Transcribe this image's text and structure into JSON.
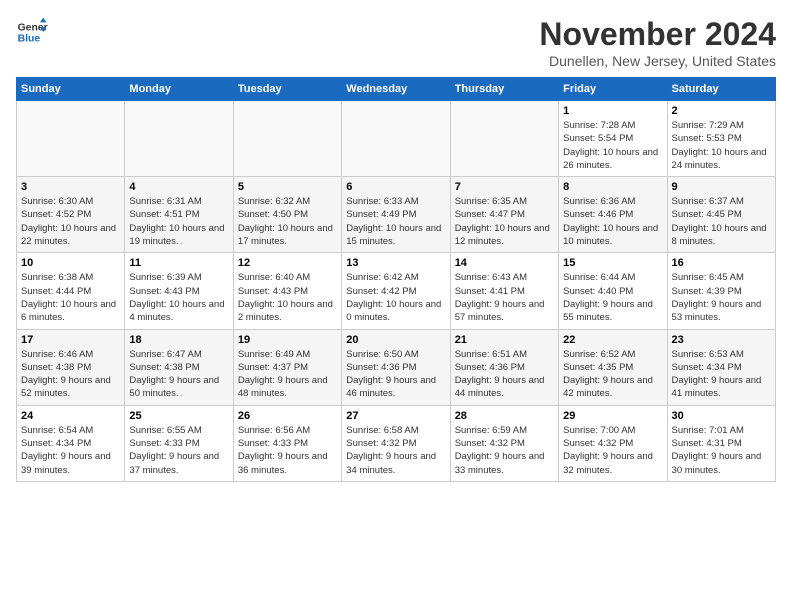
{
  "header": {
    "logo_line1": "General",
    "logo_line2": "Blue",
    "month_title": "November 2024",
    "location": "Dunellen, New Jersey, United States"
  },
  "weekdays": [
    "Sunday",
    "Monday",
    "Tuesday",
    "Wednesday",
    "Thursday",
    "Friday",
    "Saturday"
  ],
  "weeks": [
    [
      {
        "day": "",
        "info": ""
      },
      {
        "day": "",
        "info": ""
      },
      {
        "day": "",
        "info": ""
      },
      {
        "day": "",
        "info": ""
      },
      {
        "day": "",
        "info": ""
      },
      {
        "day": "1",
        "info": "Sunrise: 7:28 AM\nSunset: 5:54 PM\nDaylight: 10 hours and 26 minutes."
      },
      {
        "day": "2",
        "info": "Sunrise: 7:29 AM\nSunset: 5:53 PM\nDaylight: 10 hours and 24 minutes."
      }
    ],
    [
      {
        "day": "3",
        "info": "Sunrise: 6:30 AM\nSunset: 4:52 PM\nDaylight: 10 hours and 22 minutes."
      },
      {
        "day": "4",
        "info": "Sunrise: 6:31 AM\nSunset: 4:51 PM\nDaylight: 10 hours and 19 minutes."
      },
      {
        "day": "5",
        "info": "Sunrise: 6:32 AM\nSunset: 4:50 PM\nDaylight: 10 hours and 17 minutes."
      },
      {
        "day": "6",
        "info": "Sunrise: 6:33 AM\nSunset: 4:49 PM\nDaylight: 10 hours and 15 minutes."
      },
      {
        "day": "7",
        "info": "Sunrise: 6:35 AM\nSunset: 4:47 PM\nDaylight: 10 hours and 12 minutes."
      },
      {
        "day": "8",
        "info": "Sunrise: 6:36 AM\nSunset: 4:46 PM\nDaylight: 10 hours and 10 minutes."
      },
      {
        "day": "9",
        "info": "Sunrise: 6:37 AM\nSunset: 4:45 PM\nDaylight: 10 hours and 8 minutes."
      }
    ],
    [
      {
        "day": "10",
        "info": "Sunrise: 6:38 AM\nSunset: 4:44 PM\nDaylight: 10 hours and 6 minutes."
      },
      {
        "day": "11",
        "info": "Sunrise: 6:39 AM\nSunset: 4:43 PM\nDaylight: 10 hours and 4 minutes."
      },
      {
        "day": "12",
        "info": "Sunrise: 6:40 AM\nSunset: 4:43 PM\nDaylight: 10 hours and 2 minutes."
      },
      {
        "day": "13",
        "info": "Sunrise: 6:42 AM\nSunset: 4:42 PM\nDaylight: 10 hours and 0 minutes."
      },
      {
        "day": "14",
        "info": "Sunrise: 6:43 AM\nSunset: 4:41 PM\nDaylight: 9 hours and 57 minutes."
      },
      {
        "day": "15",
        "info": "Sunrise: 6:44 AM\nSunset: 4:40 PM\nDaylight: 9 hours and 55 minutes."
      },
      {
        "day": "16",
        "info": "Sunrise: 6:45 AM\nSunset: 4:39 PM\nDaylight: 9 hours and 53 minutes."
      }
    ],
    [
      {
        "day": "17",
        "info": "Sunrise: 6:46 AM\nSunset: 4:38 PM\nDaylight: 9 hours and 52 minutes."
      },
      {
        "day": "18",
        "info": "Sunrise: 6:47 AM\nSunset: 4:38 PM\nDaylight: 9 hours and 50 minutes."
      },
      {
        "day": "19",
        "info": "Sunrise: 6:49 AM\nSunset: 4:37 PM\nDaylight: 9 hours and 48 minutes."
      },
      {
        "day": "20",
        "info": "Sunrise: 6:50 AM\nSunset: 4:36 PM\nDaylight: 9 hours and 46 minutes."
      },
      {
        "day": "21",
        "info": "Sunrise: 6:51 AM\nSunset: 4:36 PM\nDaylight: 9 hours and 44 minutes."
      },
      {
        "day": "22",
        "info": "Sunrise: 6:52 AM\nSunset: 4:35 PM\nDaylight: 9 hours and 42 minutes."
      },
      {
        "day": "23",
        "info": "Sunrise: 6:53 AM\nSunset: 4:34 PM\nDaylight: 9 hours and 41 minutes."
      }
    ],
    [
      {
        "day": "24",
        "info": "Sunrise: 6:54 AM\nSunset: 4:34 PM\nDaylight: 9 hours and 39 minutes."
      },
      {
        "day": "25",
        "info": "Sunrise: 6:55 AM\nSunset: 4:33 PM\nDaylight: 9 hours and 37 minutes."
      },
      {
        "day": "26",
        "info": "Sunrise: 6:56 AM\nSunset: 4:33 PM\nDaylight: 9 hours and 36 minutes."
      },
      {
        "day": "27",
        "info": "Sunrise: 6:58 AM\nSunset: 4:32 PM\nDaylight: 9 hours and 34 minutes."
      },
      {
        "day": "28",
        "info": "Sunrise: 6:59 AM\nSunset: 4:32 PM\nDaylight: 9 hours and 33 minutes."
      },
      {
        "day": "29",
        "info": "Sunrise: 7:00 AM\nSunset: 4:32 PM\nDaylight: 9 hours and 32 minutes."
      },
      {
        "day": "30",
        "info": "Sunrise: 7:01 AM\nSunset: 4:31 PM\nDaylight: 9 hours and 30 minutes."
      }
    ]
  ]
}
